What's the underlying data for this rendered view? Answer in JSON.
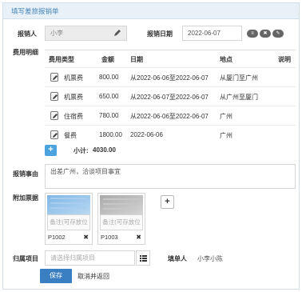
{
  "panel_title": "填写差旅报销单",
  "form": {
    "applicant_label": "报销人",
    "applicant_value": "小李",
    "date_label": "报销日期",
    "date_value": "2022-06-07",
    "detail_label": "费用明细",
    "reason_label": "报销事由",
    "reason_value": "出差广州，洽谈项目事宜",
    "attach_label": "附加票据",
    "project_label": "归属项目",
    "project_placeholder": "请选择归属项目",
    "filler_label": "填单人",
    "filler_value": "小李小陈"
  },
  "table": {
    "headers": [
      "费用类型",
      "金额",
      "日期",
      "地点",
      "说明"
    ],
    "rows": [
      {
        "type": "机票费",
        "amount": "800.00",
        "date": "从2022-06-06至2022-06-07",
        "place": "从厦门至广州",
        "note": ""
      },
      {
        "type": "机票费",
        "amount": "650.00",
        "date": "从2022-06-07至2022-06-07",
        "place": "从广州至厦门",
        "note": ""
      },
      {
        "type": "住宿费",
        "amount": "780.00",
        "date": "从2022-06-06至2022-06-07",
        "place": "广州",
        "note": ""
      },
      {
        "type": "餐费",
        "amount": "1800.00",
        "date": "2022-06-06",
        "place": "广州",
        "note": ""
      }
    ],
    "subtotal_label": "小计:",
    "subtotal_value": "4030.00"
  },
  "attachments": [
    {
      "note_placeholder": "备注(可存放位",
      "code": "P1002"
    },
    {
      "note_placeholder": "备注(可存放位",
      "code": "P1003"
    }
  ],
  "buttons": {
    "save": "保存",
    "cancel": "取消并返回",
    "add_row": "+",
    "add_attachment": "+",
    "remove": "✖"
  },
  "date_pills": [
    "≡",
    "✖",
    "✎"
  ],
  "colors": {
    "accent": "#3a7fc1",
    "add_blue": "#4aa3df",
    "header_bg": "#e8f1f8",
    "header_text": "#4a86b8"
  }
}
